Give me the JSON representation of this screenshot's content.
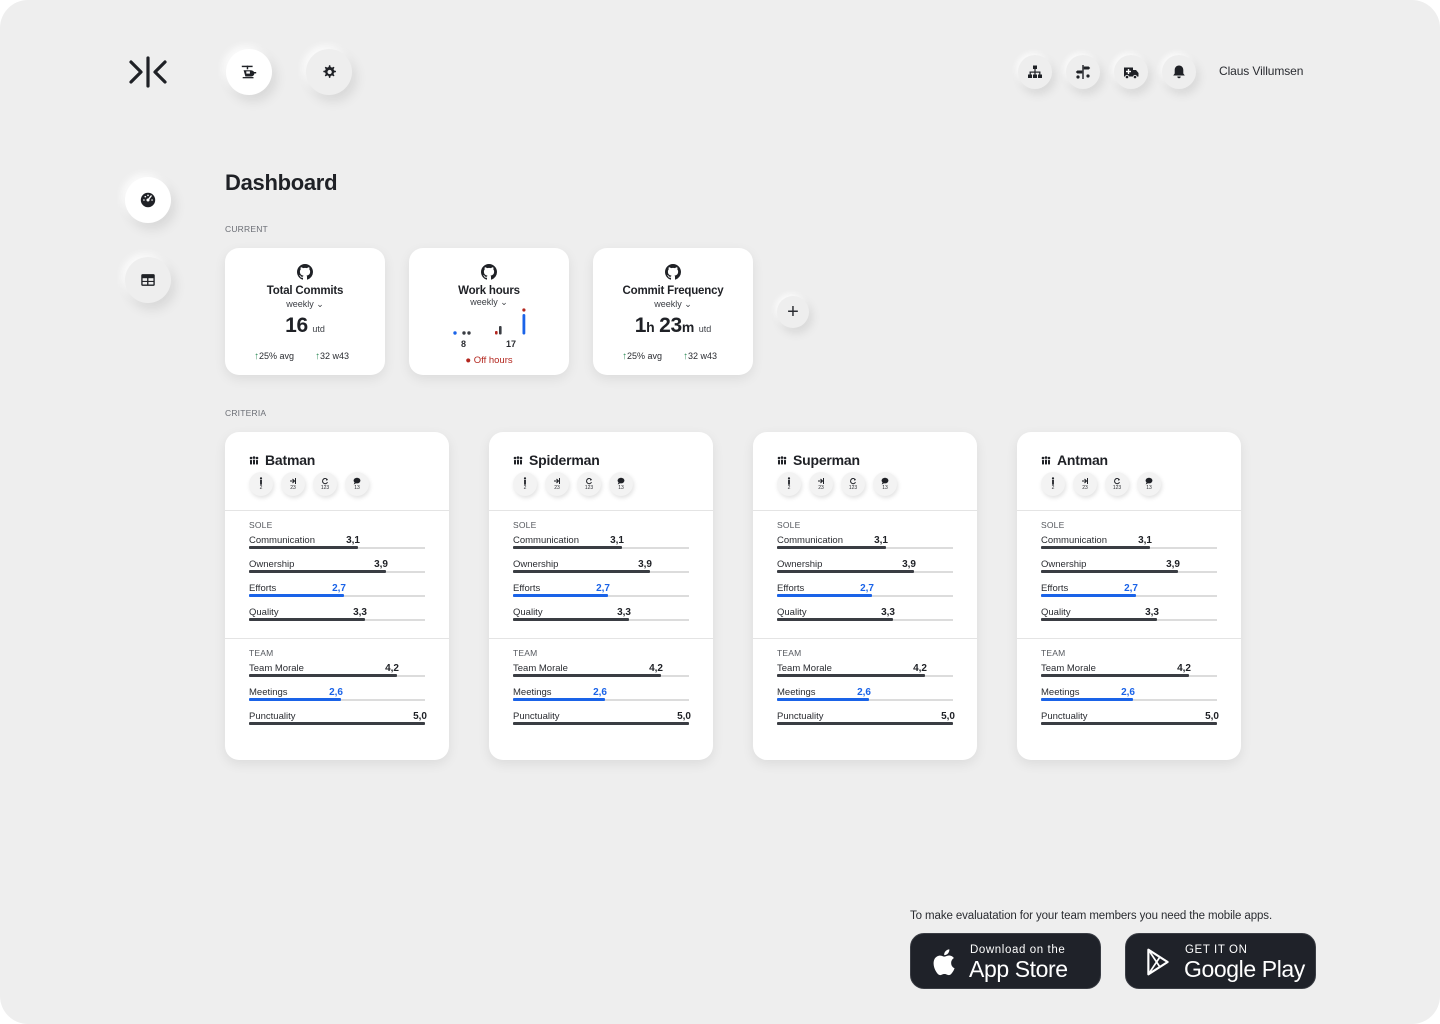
{
  "header": {
    "user_name": "Claus Villumsen",
    "nav_icons": [
      "helicopter-icon",
      "gear-icon"
    ],
    "action_icons": [
      "sitemap-icon",
      "signpost-icon",
      "ambulance-icon",
      "bell-icon"
    ]
  },
  "sidebar": {
    "items": [
      "dashboard-gauge-icon",
      "table-icon"
    ]
  },
  "page": {
    "title": "Dashboard",
    "current_label": "CURRENT",
    "criteria_label": "CRITERIA"
  },
  "kpis": {
    "total_commits": {
      "title": "Total Commits",
      "period": "weekly",
      "value": "16",
      "unit": "utd",
      "avg": "25% avg",
      "week": "32 w43"
    },
    "work_hours": {
      "title": "Work hours",
      "period": "weekly",
      "start": "8",
      "end": "17",
      "note": "Off hours"
    },
    "commit_frequency": {
      "title": "Commit Frequency",
      "period": "weekly",
      "hours": "1",
      "hours_unit": "h",
      "minutes": "23",
      "minutes_unit": "m",
      "unit": "utd",
      "avg": "25% avg",
      "week": "32 w43"
    },
    "add_label": "+"
  },
  "people": [
    {
      "name": "Batman",
      "badges": [
        "2",
        "23",
        "123",
        "13"
      ],
      "sole_label": "SOLE",
      "sole": [
        {
          "name": "Communication",
          "value": "3,1",
          "score": 3.1,
          "highlight": false
        },
        {
          "name": "Ownership",
          "value": "3,9",
          "score": 3.9,
          "highlight": false
        },
        {
          "name": "Efforts",
          "value": "2,7",
          "score": 2.7,
          "highlight": true
        },
        {
          "name": "Quality",
          "value": "3,3",
          "score": 3.3,
          "highlight": false
        }
      ],
      "team_label": "TEAM",
      "team": [
        {
          "name": "Team Morale",
          "value": "4,2",
          "score": 4.2,
          "highlight": false
        },
        {
          "name": "Meetings",
          "value": "2,6",
          "score": 2.6,
          "highlight": true
        },
        {
          "name": "Punctuality",
          "value": "5,0",
          "score": 5.0,
          "highlight": false
        }
      ]
    },
    {
      "name": "Spiderman",
      "badges": [
        "2",
        "23",
        "123",
        "13"
      ],
      "sole_label": "SOLE",
      "sole": [
        {
          "name": "Communication",
          "value": "3,1",
          "score": 3.1,
          "highlight": false
        },
        {
          "name": "Ownership",
          "value": "3,9",
          "score": 3.9,
          "highlight": false
        },
        {
          "name": "Efforts",
          "value": "2,7",
          "score": 2.7,
          "highlight": true
        },
        {
          "name": "Quality",
          "value": "3,3",
          "score": 3.3,
          "highlight": false
        }
      ],
      "team_label": "TEAM",
      "team": [
        {
          "name": "Team Morale",
          "value": "4,2",
          "score": 4.2,
          "highlight": false
        },
        {
          "name": "Meetings",
          "value": "2,6",
          "score": 2.6,
          "highlight": true
        },
        {
          "name": "Punctuality",
          "value": "5,0",
          "score": 5.0,
          "highlight": false
        }
      ]
    },
    {
      "name": "Superman",
      "badges": [
        "2",
        "23",
        "123",
        "13"
      ],
      "sole_label": "SOLE",
      "sole": [
        {
          "name": "Communication",
          "value": "3,1",
          "score": 3.1,
          "highlight": false
        },
        {
          "name": "Ownership",
          "value": "3,9",
          "score": 3.9,
          "highlight": false
        },
        {
          "name": "Efforts",
          "value": "2,7",
          "score": 2.7,
          "highlight": true
        },
        {
          "name": "Quality",
          "value": "3,3",
          "score": 3.3,
          "highlight": false
        }
      ],
      "team_label": "TEAM",
      "team": [
        {
          "name": "Team Morale",
          "value": "4,2",
          "score": 4.2,
          "highlight": false
        },
        {
          "name": "Meetings",
          "value": "2,6",
          "score": 2.6,
          "highlight": true
        },
        {
          "name": "Punctuality",
          "value": "5,0",
          "score": 5.0,
          "highlight": false
        }
      ]
    },
    {
      "name": "Antman",
      "badges": [
        "2",
        "23",
        "123",
        "13"
      ],
      "sole_label": "SOLE",
      "sole": [
        {
          "name": "Communication",
          "value": "3,1",
          "score": 3.1,
          "highlight": false
        },
        {
          "name": "Ownership",
          "value": "3,9",
          "score": 3.9,
          "highlight": false
        },
        {
          "name": "Efforts",
          "value": "2,7",
          "score": 2.7,
          "highlight": true
        },
        {
          "name": "Quality",
          "value": "3,3",
          "score": 3.3,
          "highlight": false
        }
      ],
      "team_label": "TEAM",
      "team": [
        {
          "name": "Team Morale",
          "value": "4,2",
          "score": 4.2,
          "highlight": false
        },
        {
          "name": "Meetings",
          "value": "2,6",
          "score": 2.6,
          "highlight": true
        },
        {
          "name": "Punctuality",
          "value": "5,0",
          "score": 5.0,
          "highlight": false
        }
      ]
    }
  ],
  "score_max": 5,
  "footer": {
    "notice": "To make evaluatation for your team members you need the mobile apps.",
    "app_store": {
      "small": "Download on the",
      "big": "App Store"
    },
    "google_play": {
      "small": "GET IT ON",
      "big": "Google Play"
    }
  },
  "colors": {
    "accent_blue": "#1a63e8",
    "bar_dark": "#3a3d43",
    "off_hours_red": "#b3261e",
    "trend_green": "#2e8b57"
  }
}
